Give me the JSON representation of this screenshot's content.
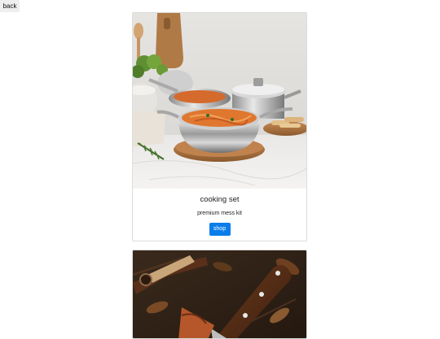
{
  "nav": {
    "back_label": "back"
  },
  "products": [
    {
      "title": "cooking set",
      "subtitle": "premium mess kit",
      "button_label": "shop"
    }
  ],
  "colors": {
    "accent": "#0b7dea",
    "card_border": "#dcdcdc",
    "back_bg": "#efefef"
  }
}
